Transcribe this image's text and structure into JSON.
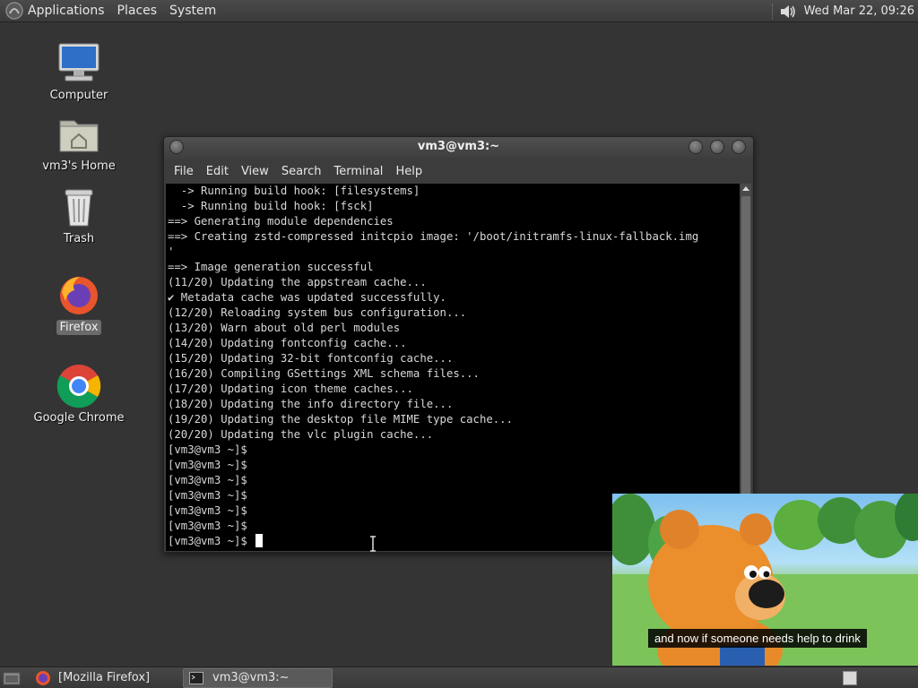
{
  "top_panel": {
    "menus": [
      "Applications",
      "Places",
      "System"
    ],
    "clock": "Wed Mar 22, 09:26",
    "icons": [
      "mate-logo-icon",
      "volume-icon"
    ]
  },
  "desktop": {
    "icons": [
      {
        "label": "Computer",
        "icon": "computer-icon"
      },
      {
        "label": "vm3's Home",
        "icon": "home-folder-icon"
      },
      {
        "label": "Trash",
        "icon": "trash-icon"
      },
      {
        "label": "Firefox",
        "icon": "firefox-icon",
        "selected": true
      },
      {
        "label": "Google Chrome",
        "icon": "chrome-icon"
      }
    ]
  },
  "terminal": {
    "title": "vm3@vm3:~",
    "menu": [
      "File",
      "Edit",
      "View",
      "Search",
      "Terminal",
      "Help"
    ],
    "lines": [
      "  -> Running build hook: [filesystems]",
      "  -> Running build hook: [fsck]",
      "==> Generating module dependencies",
      "==> Creating zstd-compressed initcpio image: '/boot/initramfs-linux-fallback.img",
      "'",
      "==> Image generation successful",
      "(11/20) Updating the appstream cache...",
      "✔ Metadata cache was updated successfully.",
      "(12/20) Reloading system bus configuration...",
      "(13/20) Warn about old perl modules",
      "(14/20) Updating fontconfig cache...",
      "(15/20) Updating 32-bit fontconfig cache...",
      "(16/20) Compiling GSettings XML schema files...",
      "(17/20) Updating icon theme caches...",
      "(18/20) Updating the info directory file...",
      "(19/20) Updating the desktop file MIME type cache...",
      "(20/20) Updating the vlc plugin cache...",
      "[vm3@vm3 ~]$",
      "[vm3@vm3 ~]$",
      "[vm3@vm3 ~]$",
      "[vm3@vm3 ~]$",
      "[vm3@vm3 ~]$",
      "[vm3@vm3 ~]$",
      "[vm3@vm3 ~]$ "
    ]
  },
  "video": {
    "caption": "and now if someone needs help to drink"
  },
  "bottom_panel": {
    "tasks": [
      {
        "label": "[Mozilla Firefox]",
        "icon": "firefox-icon",
        "active": false
      },
      {
        "label": "vm3@vm3:~",
        "icon": "terminal-icon",
        "active": true
      }
    ]
  },
  "colors": {
    "panel": "#3e3e3e",
    "desktop": "#343434",
    "terminal_bg": "#000000",
    "terminal_fg": "#d8d8d8"
  }
}
